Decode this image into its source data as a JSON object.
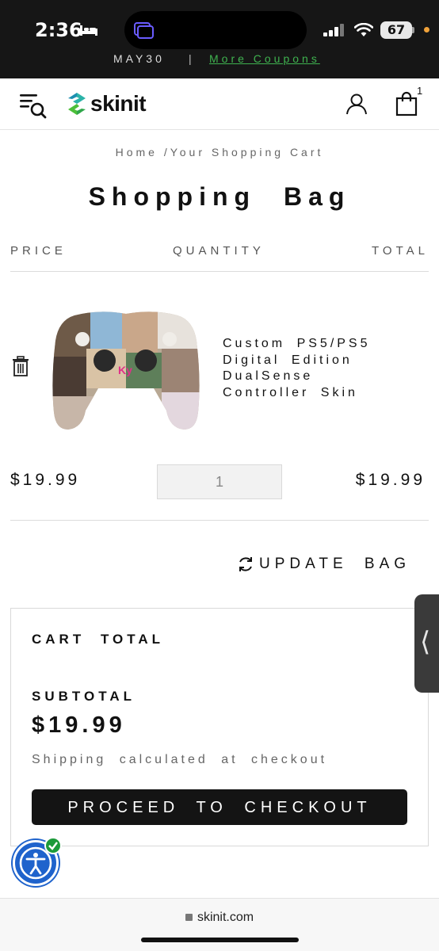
{
  "status_bar": {
    "time": "2:36",
    "battery": "67"
  },
  "promo_bar": {
    "code_text": "MAY30",
    "separator": "|",
    "more_coupons": "More Coupons"
  },
  "header": {
    "logo_text": "skinit",
    "cart_count": "1",
    "brand_colors": {
      "green": "#3fb24f",
      "teal": "#1aa3a3"
    }
  },
  "breadcrumb": {
    "home": "Home",
    "separator": "/",
    "current": "Your Shopping Cart"
  },
  "page_title": "Shopping Bag",
  "cart_table": {
    "columns": [
      "PRICE",
      "QUANTITY",
      "TOTAL"
    ],
    "items": [
      {
        "name_lines": [
          "Custom PS5/PS5",
          "Digital Edition",
          "DualSense",
          "Controller Skin"
        ],
        "price": "$19.99",
        "quantity": "1",
        "total": "$19.99"
      }
    ]
  },
  "update_bag_label": "UPDATE BAG",
  "cart_total": {
    "heading": "CART TOTAL",
    "subtotal_label": "SUBTOTAL",
    "subtotal_value": "$19.99",
    "shipping_note": "Shipping calculated at checkout",
    "checkout_label": "PROCEED TO CHECKOUT"
  },
  "side_tab_icon": "chevron-left-icon",
  "accessibility_icon": "accessibility-icon",
  "browser": {
    "url": "skinit.com"
  }
}
